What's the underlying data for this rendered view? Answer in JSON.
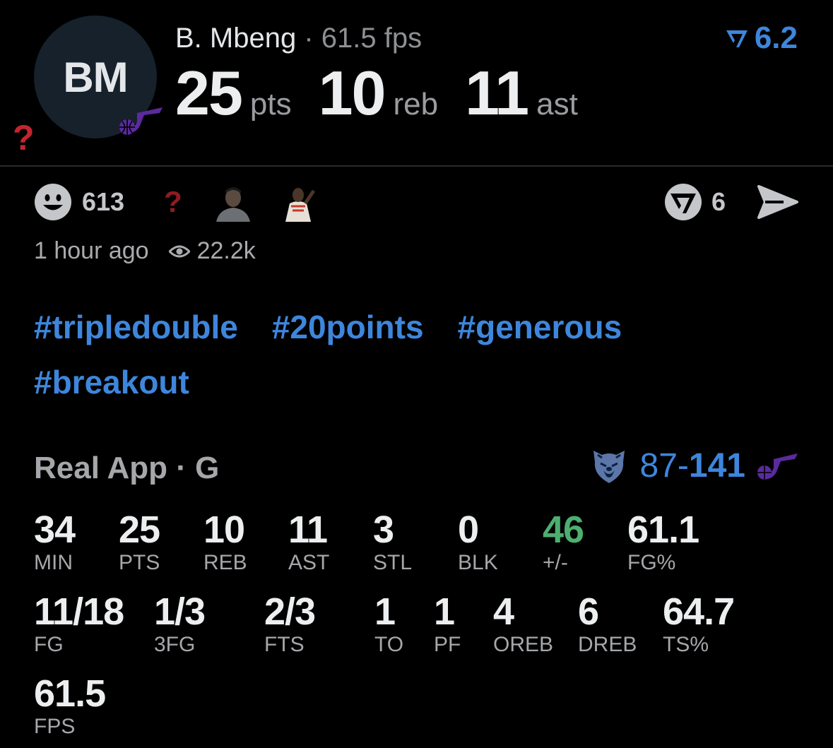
{
  "player": {
    "initials": "BM",
    "name": "B. Mbeng",
    "separator": "·",
    "fps_text": "61.5 fps"
  },
  "rating": {
    "icon": "verified-v-icon",
    "value": "6.2"
  },
  "headline": [
    {
      "value": "25",
      "unit": "pts"
    },
    {
      "value": "10",
      "unit": "reb"
    },
    {
      "value": "11",
      "unit": "ast"
    }
  ],
  "reactions": {
    "count": "613",
    "question_glyph": "?"
  },
  "actions": {
    "count": "6"
  },
  "meta": {
    "time": "1 hour ago",
    "views": "22.2k"
  },
  "tags": [
    "#tripledouble",
    "#20points",
    "#generous",
    "#breakout"
  ],
  "game": {
    "title": "Real App · G",
    "score_away": "87",
    "score_sep": "-",
    "score_home": "141"
  },
  "stats_row1": [
    {
      "value": "34",
      "label": "MIN"
    },
    {
      "value": "25",
      "label": "PTS"
    },
    {
      "value": "10",
      "label": "REB"
    },
    {
      "value": "11",
      "label": "AST"
    },
    {
      "value": "3",
      "label": "STL"
    },
    {
      "value": "0",
      "label": "BLK"
    },
    {
      "value": "46",
      "label": "+/-"
    },
    {
      "value": "61.1",
      "label": "FG%"
    }
  ],
  "stats_row2": [
    {
      "value": "11/18",
      "label": "FG"
    },
    {
      "value": "1/3",
      "label": "3FG"
    },
    {
      "value": "2/3",
      "label": "FTS"
    },
    {
      "value": "1",
      "label": "TO"
    },
    {
      "value": "1",
      "label": "PF"
    },
    {
      "value": "4",
      "label": "OREB"
    },
    {
      "value": "6",
      "label": "DREB"
    },
    {
      "value": "64.7",
      "label": "TS%"
    }
  ],
  "stats_row3": [
    {
      "value": "61.5",
      "label": "FPS"
    }
  ],
  "colors": {
    "accent_blue": "#3e86dc",
    "positive_green": "#4caf6e",
    "question_red": "#c3252f",
    "jazz_purple": "#5b2a9e"
  }
}
